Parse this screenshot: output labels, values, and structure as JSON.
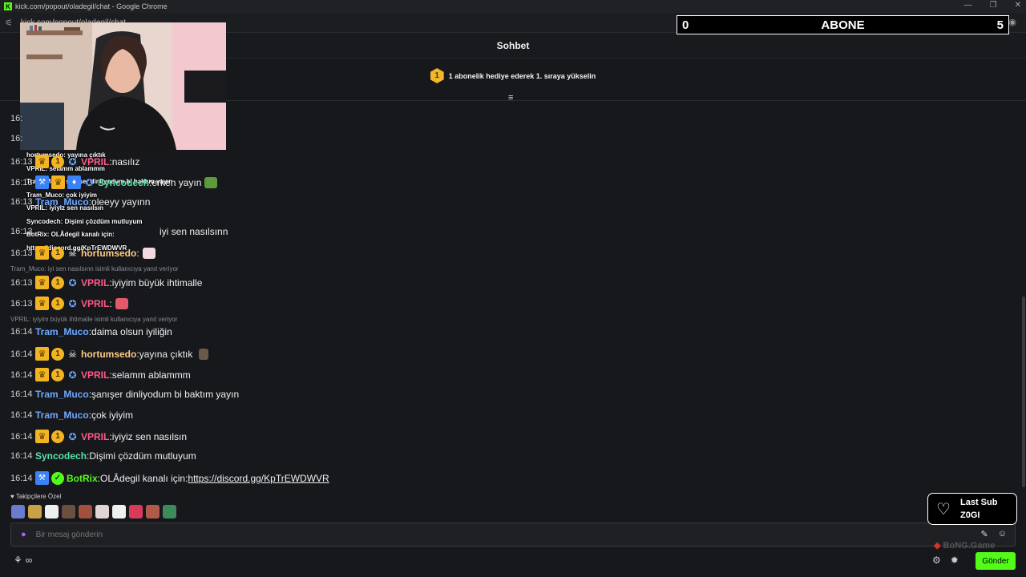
{
  "window": {
    "title": "kick.com/popout/oladegil/chat - Google Chrome",
    "url": "kick.com/popout/oladegil/chat"
  },
  "header": {
    "title": "Sohbet"
  },
  "pinned": {
    "badge": "1",
    "text": "1 abonelik hediye ederek 1. sıraya yükselin"
  },
  "overlay_score": {
    "left": "0",
    "label": "ABONE",
    "right": "5"
  },
  "overlay_ghost_lines": [
    "hortumsedo: yayına çıktık",
    "VPRIL: selamm ablammm",
    "Tram_Muco: şanışer dinliyodum bi baktım yayın",
    "Tram_Muco: çok iyiyim",
    "VPRIL: iyiyiz sen nasılsın",
    "Syncodech: Dişimi çözdüm mutluyum",
    "BotRix: OLÂdegil kanalı için:",
    "https://discord.gg/KpTrEWDWVR"
  ],
  "partial_times": [
    "16:",
    "16:"
  ],
  "messages": [
    {
      "time": "16:13",
      "user": "VPRIL",
      "sep": ": ",
      "text": "nasılız"
    },
    {
      "time": "16:13",
      "user": "Syncodech",
      "sep": ": ",
      "text": "erken yayın"
    },
    {
      "time": "16:13",
      "user": "Tram_Muco",
      "sep": ": ",
      "text": "oleeyy yayınn"
    },
    {
      "time": "16:13",
      "user": "",
      "sep": "",
      "text": "iyi sen nasılsınn"
    },
    {
      "time": "16:13",
      "user": "hortumsedo",
      "sep": ":",
      "text": ""
    },
    {
      "time": "16:13",
      "user": "VPRIL",
      "sep": ": ",
      "text": "iyiyim büyük ihtimalle"
    },
    {
      "time": "16:13",
      "user": "VPRIL",
      "sep": ":",
      "text": ""
    },
    {
      "time": "16:14",
      "user": "Tram_Muco",
      "sep": ": ",
      "text": "daima olsun iyiliğin"
    },
    {
      "time": "16:14",
      "user": "hortumsedo",
      "sep": ": ",
      "text": "yayına çıktık"
    },
    {
      "time": "16:14",
      "user": "VPRIL",
      "sep": ": ",
      "text": "selamm ablammm"
    },
    {
      "time": "16:14",
      "user": "Tram_Muco",
      "sep": ": ",
      "text": "şanışer dinliyodum bi baktım yayın"
    },
    {
      "time": "16:14",
      "user": "Tram_Muco",
      "sep": ": ",
      "text": "çok iyiyim"
    },
    {
      "time": "16:14",
      "user": "VPRIL",
      "sep": ": ",
      "text": "iyiyiz sen nasılsın"
    },
    {
      "time": "16:14",
      "user": "Syncodech",
      "sep": ": ",
      "text": "Dişimi çözdüm mutluyum"
    },
    {
      "time": "16:14",
      "user": "BotRix",
      "sep": ": ",
      "text": "OLÂdegil kanalı için: ",
      "link": "https://discord.gg/KpTrEWDWVR"
    }
  ],
  "replies": [
    "Tram_Muco: iyi sen nasılsınn isimli kullanıcıya yanıt veriyor",
    "VPRIL: iyiyim büyük ihtimalle isimli kullanıcıya yanıt veriyor"
  ],
  "follower_section": {
    "label": "Takipçilere Özel"
  },
  "input": {
    "placeholder": "Bir mesaj gönderin"
  },
  "last_sub": {
    "title": "Last Sub",
    "name": "Z0GI"
  },
  "footer": {
    "infinity": "∞",
    "send_label": "Gönder",
    "brand": "BoNG.Game"
  },
  "icons": {
    "titlebar": "kick-favicon",
    "mic": "microphone-icon",
    "emote": "emote-icon",
    "settings": "gear-icon",
    "heart": "heart-icon"
  },
  "colors": {
    "accent": "#53fc18",
    "vpril": "#ff5a87",
    "hortumsedo": "#ffcc80",
    "tram_muco": "#6ea8ff",
    "syncodech": "#55e3a8",
    "badge_gold": "#f3b423"
  }
}
